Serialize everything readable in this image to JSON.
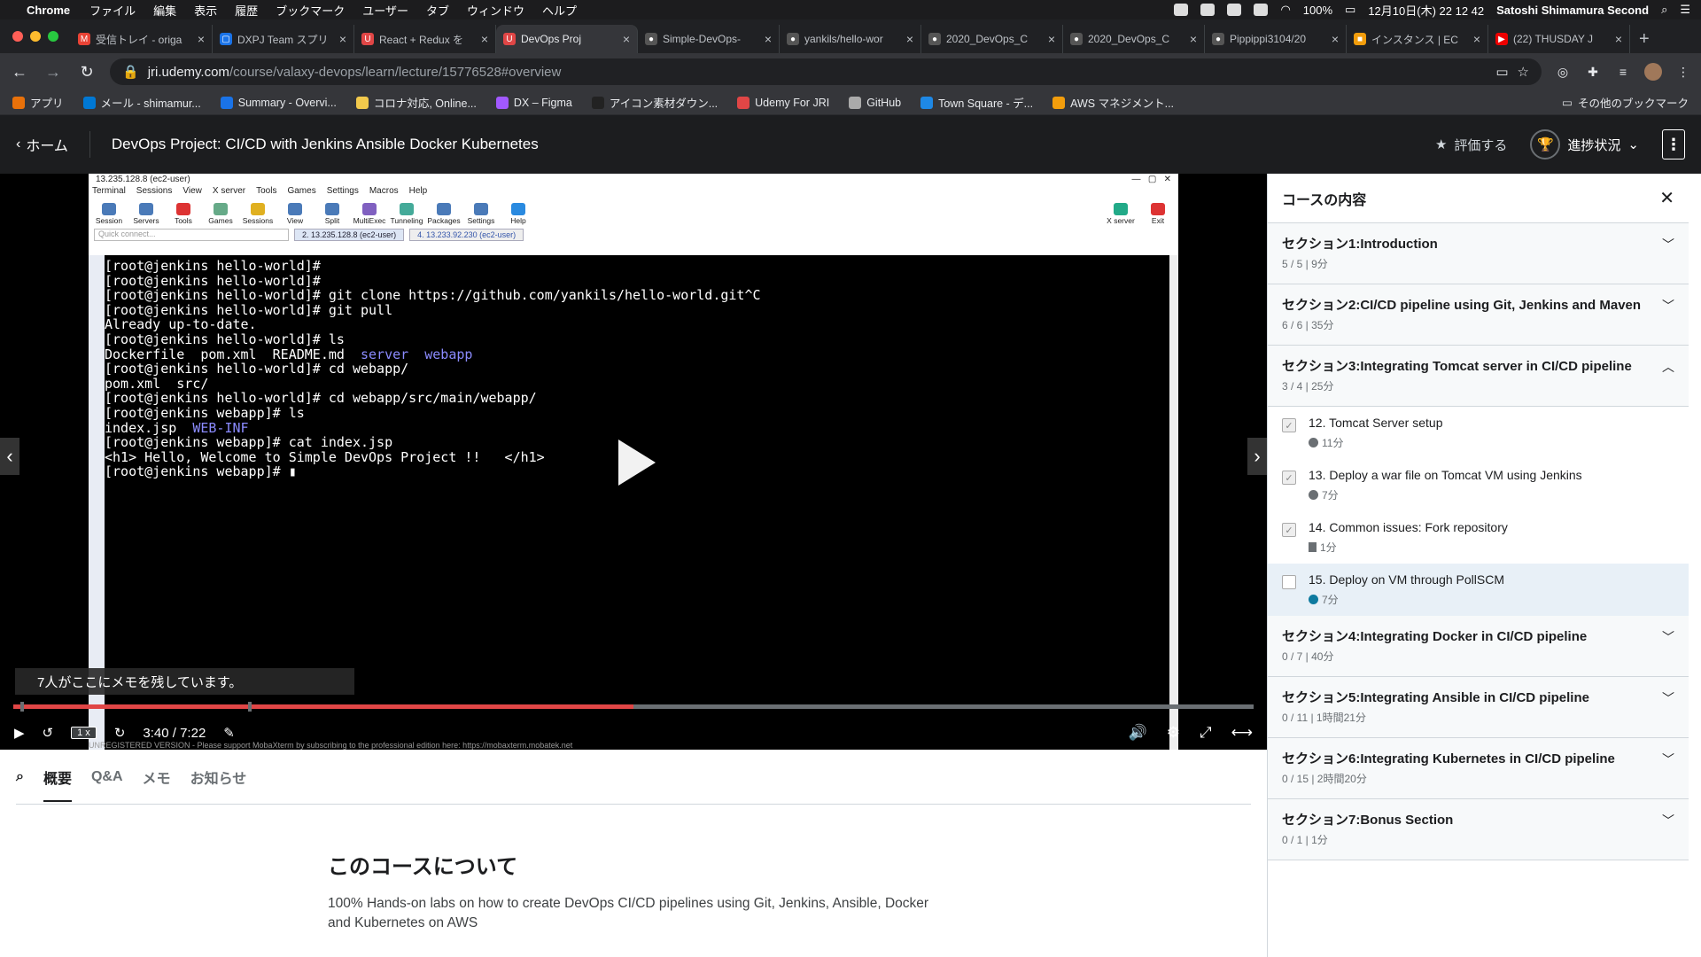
{
  "menubar": {
    "app": "Chrome",
    "items": [
      "ファイル",
      "編集",
      "表示",
      "履歴",
      "ブックマーク",
      "ユーザー",
      "タブ",
      "ウィンドウ",
      "ヘルプ"
    ],
    "battery": "100%",
    "datetime": "12月10日(木) 22 12 42",
    "user": "Satoshi Shimamura Second"
  },
  "tabs": [
    {
      "label": "受信トレイ - origa",
      "color": "#ea4335",
      "glyph": "M"
    },
    {
      "label": "DXPJ Team スプリ",
      "color": "#1a73e8",
      "glyph": "▢"
    },
    {
      "label": "React + Redux を",
      "color": "#e04646",
      "glyph": "U"
    },
    {
      "label": "DevOps Proj",
      "color": "#e04646",
      "glyph": "U",
      "active": true
    },
    {
      "label": "Simple-DevOps-",
      "color": "#555",
      "glyph": "●"
    },
    {
      "label": "yankils/hello-wor",
      "color": "#555",
      "glyph": "●"
    },
    {
      "label": "2020_DevOps_C",
      "color": "#555",
      "glyph": "●"
    },
    {
      "label": "2020_DevOps_C",
      "color": "#555",
      "glyph": "●"
    },
    {
      "label": "Pippippi3104/20",
      "color": "#555",
      "glyph": "●"
    },
    {
      "label": "インスタンス | EC",
      "color": "#f29d0c",
      "glyph": "■"
    },
    {
      "label": "(22) THUSDAY J",
      "color": "#e00",
      "glyph": "▶"
    }
  ],
  "address": {
    "host": "jri.udemy.com",
    "path": "/course/valaxy-devops/learn/lecture/15776528#overview"
  },
  "bookmarks": [
    {
      "label": "アプリ",
      "color": "#e8710a"
    },
    {
      "label": "メール - shimamur...",
      "color": "#0078d4"
    },
    {
      "label": "Summary - Overvi...",
      "color": "#1a73e8"
    },
    {
      "label": "コロナ対応, Online...",
      "color": "#f2c94c"
    },
    {
      "label": "DX – Figma",
      "color": "#a259ff"
    },
    {
      "label": "アイコン素材ダウン...",
      "color": "#222"
    },
    {
      "label": "Udemy For JRI",
      "color": "#e04646"
    },
    {
      "label": "GitHub",
      "color": "#aaa"
    },
    {
      "label": "Town Square - デ...",
      "color": "#1e88e5"
    },
    {
      "label": "AWS マネジメント...",
      "color": "#f29d0c"
    }
  ],
  "bookmark_other": "その他のブックマーク",
  "header": {
    "home": "ホーム",
    "course_title": "DevOps Project: CI/CD with Jenkins Ansible Docker Kubernetes",
    "rate": "評価する",
    "progress": "進捗状況"
  },
  "mobaxterm": {
    "title": "13.235.128.8 (ec2-user)",
    "menu": [
      "Terminal",
      "Sessions",
      "View",
      "X server",
      "Tools",
      "Games",
      "Settings",
      "Macros",
      "Help"
    ],
    "tools": [
      "Session",
      "Servers",
      "Tools",
      "Games",
      "Sessions",
      "View",
      "Split",
      "MultiExec",
      "Tunneling",
      "Packages",
      "Settings",
      "Help"
    ],
    "quick_connect": "Quick connect...",
    "tab1": "2. 13.235.128.8 (ec2-user)",
    "tab2": "4. 13.233.92.230 (ec2-user)",
    "xserver": "X server",
    "exit": "Exit",
    "footer": "UNREGISTERED VERSION  -  Please support MobaXterm by subscribing to the professional edition here:  https://mobaxterm.mobatek.net"
  },
  "terminal_lines": [
    {
      "t": "[root@jenkins hello-world]#"
    },
    {
      "t": "[root@jenkins hello-world]#"
    },
    {
      "t": "[root@jenkins hello-world]# git clone https://github.com/yankils/hello-world.git^C"
    },
    {
      "t": "[root@jenkins hello-world]# git pull"
    },
    {
      "t": "Already up-to-date."
    },
    {
      "t": "[root@jenkins hello-world]# ls"
    },
    {
      "t": "Dockerfile  pom.xml  README.md  ",
      "blue": "server  webapp"
    },
    {
      "t": "[root@jenkins hello-world]# cd webapp/"
    },
    {
      "t": "pom.xml  src/"
    },
    {
      "t": "[root@jenkins hello-world]# cd webapp/src/main/webapp/"
    },
    {
      "t": "[root@jenkins webapp]# ls"
    },
    {
      "t": "index.jsp  ",
      "blue": "WEB-INF"
    },
    {
      "t": "[root@jenkins webapp]# cat index.jsp"
    },
    {
      "t": "<h1> Hello, Welcome to Simple DevOps Project !!   </h1>"
    },
    {
      "t": "[root@jenkins webapp]# ▮"
    }
  ],
  "player": {
    "notes": "7人がここにメモを残しています。",
    "progress": 0.5,
    "speed": "1 x",
    "time": "3:40 / 7:22"
  },
  "sidebar": {
    "title": "コースの内容",
    "sections": [
      {
        "title": "セクション1:Introduction",
        "meta": "5 / 5 | 9分",
        "expanded": false
      },
      {
        "title": "セクション2:CI/CD pipeline using Git, Jenkins and Maven",
        "meta": "6 / 6 | 35分",
        "expanded": false
      },
      {
        "title": "セクション3:Integrating Tomcat server in CI/CD pipeline",
        "meta": "3 / 4 | 25分",
        "expanded": true,
        "lectures": [
          {
            "title": "12. Tomcat Server setup",
            "meta": "11分",
            "done": true,
            "kind": "video"
          },
          {
            "title": "13. Deploy a war file on Tomcat VM using Jenkins",
            "meta": "7分",
            "done": true,
            "kind": "video"
          },
          {
            "title": "14. Common issues: Fork repository",
            "meta": "1分",
            "done": true,
            "kind": "file"
          },
          {
            "title": "15. Deploy on VM through PollSCM",
            "meta": "7分",
            "done": false,
            "kind": "video",
            "current": true
          }
        ]
      },
      {
        "title": "セクション4:Integrating Docker in CI/CD pipeline",
        "meta": "0 / 7 | 40分",
        "expanded": false
      },
      {
        "title": "セクション5:Integrating Ansible in CI/CD pipeline",
        "meta": "0 / 11 | 1時間21分",
        "expanded": false
      },
      {
        "title": "セクション6:Integrating Kubernetes in CI/CD pipeline",
        "meta": "0 / 15 | 2時間20分",
        "expanded": false
      },
      {
        "title": "セクション7:Bonus Section",
        "meta": "0 / 1 | 1分",
        "expanded": false
      }
    ]
  },
  "bottom_tabs": [
    "概要",
    "Q&A",
    "メモ",
    "お知らせ"
  ],
  "about": {
    "heading": "このコースについて",
    "text": "100% Hands-on labs on how to create DevOps CI/CD pipelines using Git, Jenkins, Ansible, Docker and Kubernetes on AWS"
  }
}
